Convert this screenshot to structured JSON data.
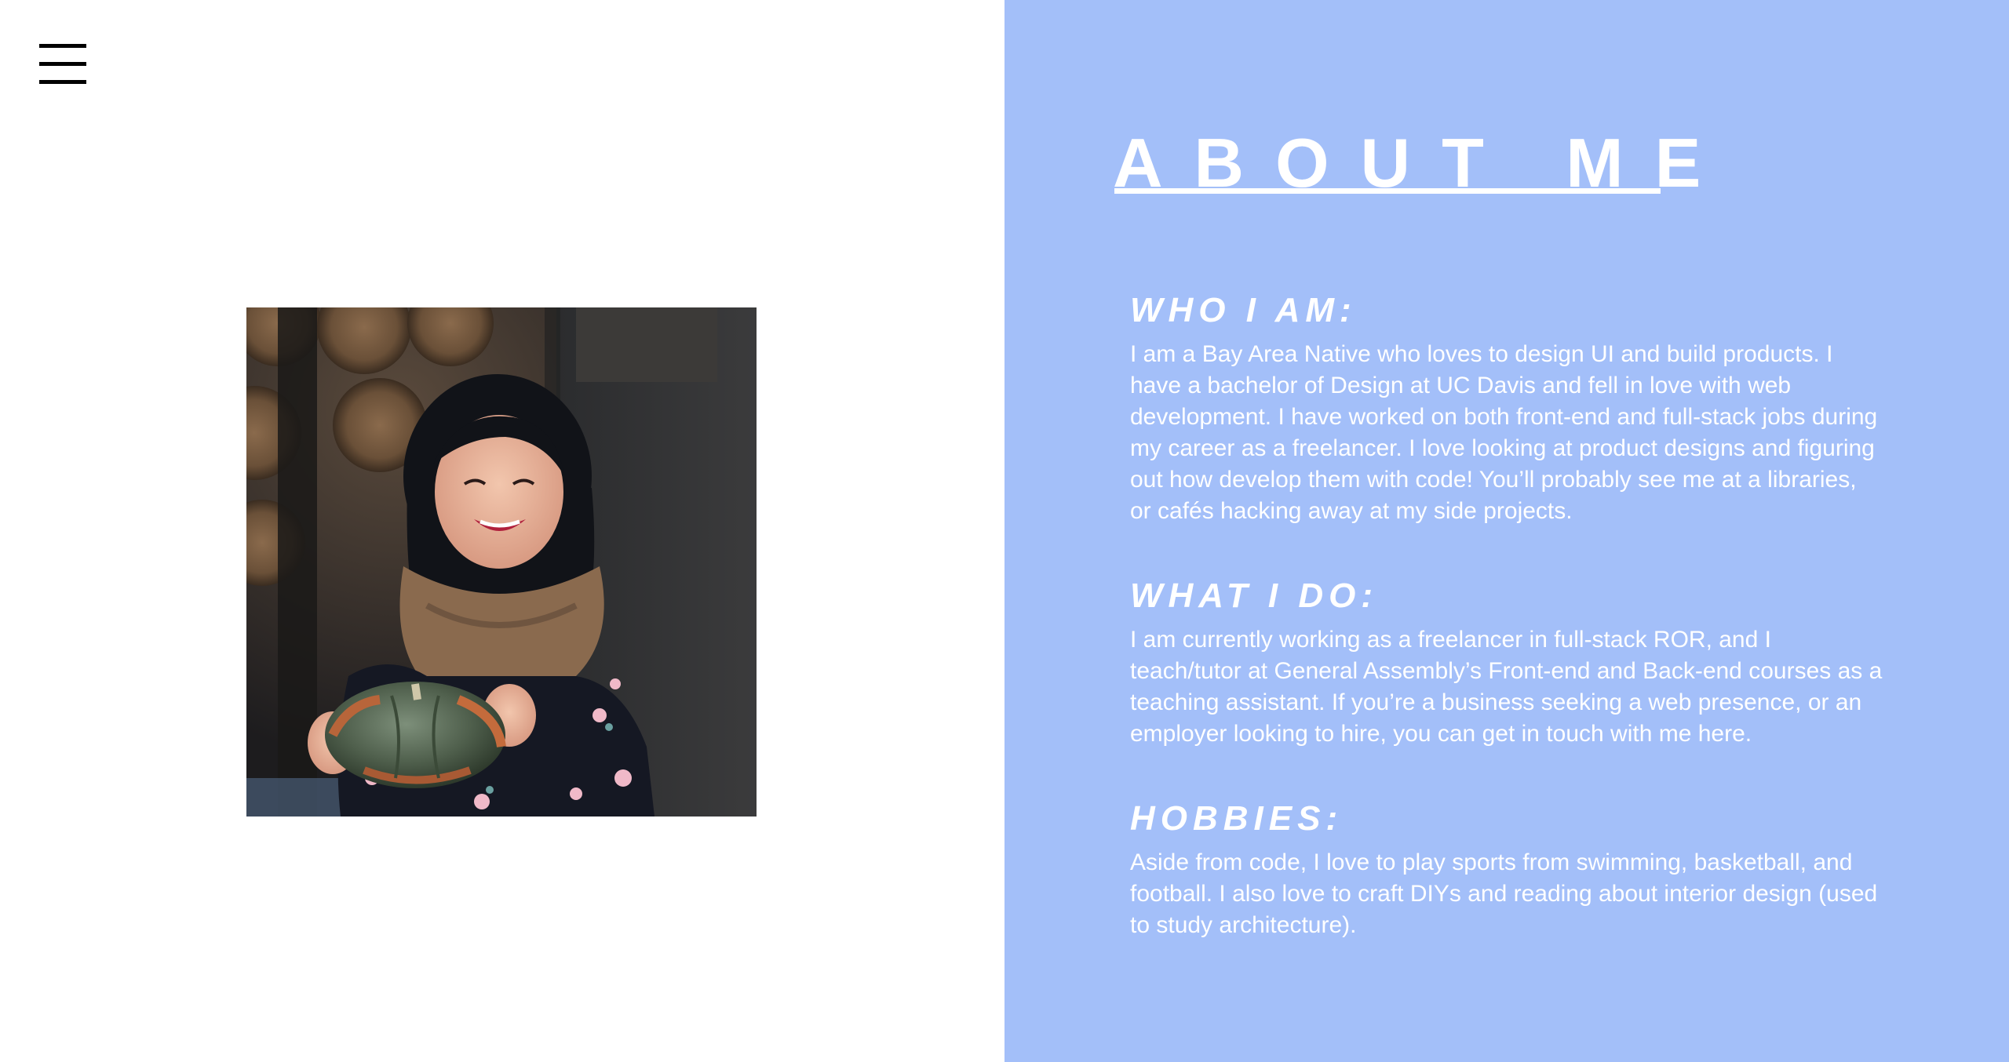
{
  "nav": {
    "menu_icon": "hamburger-menu-icon"
  },
  "photo": {
    "description": "portrait-photo"
  },
  "about": {
    "title": "ABOUT ME",
    "sections": [
      {
        "heading": "WHO I AM:",
        "body": "I am a Bay Area Native who loves to design UI and build products. I have a bachelor of Design at UC Davis and fell in love with web development. I have worked on both front-end and full-stack jobs during my career as a freelancer. I love looking at product designs and figuring out how develop them with code! You’ll probably see me at a libraries, or cafés hacking away at my side projects."
      },
      {
        "heading": "WHAT I DO:",
        "body": "I am currently working as a freelancer in full-stack ROR, and I teach/tutor at General Assembly’s Front-end and Back-end courses as a teaching assistant. If you’re a business seeking a web presence, or an employer looking to hire, you can get in touch with me here."
      },
      {
        "heading": "HOBBIES:",
        "body": "Aside from code, I love to play sports from swimming, basketball, and football. I also love to craft DIYs and reading about interior design (used to study architecture)."
      }
    ]
  },
  "colors": {
    "panel_background": "#a3bff9",
    "text": "#ffffff",
    "menu_icon": "#000000"
  }
}
